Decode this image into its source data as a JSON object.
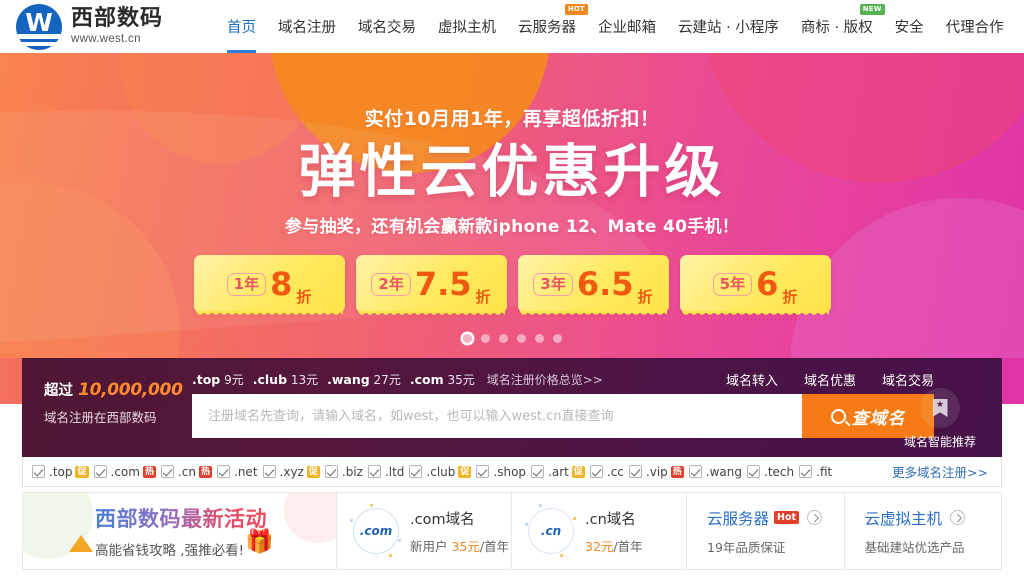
{
  "header": {
    "logo": {
      "name": "西部数码",
      "url": "www.west.cn",
      "icon": "west-logo-icon"
    },
    "nav": [
      {
        "label": "首页",
        "active": true,
        "badge": ""
      },
      {
        "label": "域名注册",
        "active": false,
        "badge": ""
      },
      {
        "label": "域名交易",
        "active": false,
        "badge": ""
      },
      {
        "label": "虚拟主机",
        "active": false,
        "badge": ""
      },
      {
        "label": "云服务器",
        "active": false,
        "badge": "HOT"
      },
      {
        "label": "企业邮箱",
        "active": false,
        "badge": ""
      },
      {
        "label": "云建站 · 小程序",
        "active": false,
        "badge": ""
      },
      {
        "label": "商标 · 版权",
        "active": false,
        "badge": "NEW"
      },
      {
        "label": "安全",
        "active": false,
        "badge": ""
      },
      {
        "label": "代理合作",
        "active": false,
        "badge": ""
      }
    ]
  },
  "banner": {
    "subtitle_top": "实付10月用1年，再享超低折扣！",
    "title": "弹性云优惠升级",
    "subtitle_bottom": "参与抽奖，还有机会赢新款iphone 12、Mate 40手机！",
    "coupons": [
      {
        "years": "1年",
        "value": "8",
        "unit": "折"
      },
      {
        "years": "2年",
        "value": "7.5",
        "unit": "折"
      },
      {
        "years": "3年",
        "value": "6.5",
        "unit": "折"
      },
      {
        "years": "5年",
        "value": "6",
        "unit": "折"
      }
    ],
    "dots": {
      "count": 6,
      "active_index": 0
    }
  },
  "search_panel": {
    "headline": "超过",
    "headline_number": "10,000,000",
    "subline": "域名注册在西部数码",
    "tld_prices": [
      {
        "tld": ".top",
        "price": "9元"
      },
      {
        "tld": ".club",
        "price": "13元"
      },
      {
        "tld": ".wang",
        "price": "27元"
      },
      {
        "tld": ".com",
        "price": "35元"
      }
    ],
    "price_overview_link": "域名注册价格总览>>",
    "quick_links": [
      "域名转入",
      "域名优惠",
      "域名交易"
    ],
    "input_placeholder": "注册域名先查询，请输入域名，如west，也可以输入west.cn直接查询",
    "input_value": "",
    "search_button": "查域名",
    "search_icon": "magnifier-icon",
    "smart_recommend": {
      "label": "域名智能推荐",
      "icon": "bookmark-star-icon"
    }
  },
  "tld_row": {
    "items": [
      {
        "name": ".top",
        "badge": "促",
        "badge_type": "cu",
        "checked": true
      },
      {
        "name": ".com",
        "badge": "热",
        "badge_type": "re",
        "checked": true
      },
      {
        "name": ".cn",
        "badge": "热",
        "badge_type": "re",
        "checked": true
      },
      {
        "name": ".net",
        "badge": "",
        "badge_type": "",
        "checked": true
      },
      {
        "name": ".xyz",
        "badge": "促",
        "badge_type": "cu",
        "checked": true
      },
      {
        "name": ".biz",
        "badge": "",
        "badge_type": "",
        "checked": true
      },
      {
        "name": ".ltd",
        "badge": "",
        "badge_type": "",
        "checked": true
      },
      {
        "name": ".club",
        "badge": "促",
        "badge_type": "cu",
        "checked": true
      },
      {
        "name": ".shop",
        "badge": "",
        "badge_type": "",
        "checked": true
      },
      {
        "name": ".art",
        "badge": "促",
        "badge_type": "cu",
        "checked": true
      },
      {
        "name": ".cc",
        "badge": "",
        "badge_type": "",
        "checked": true
      },
      {
        "name": ".vip",
        "badge": "热",
        "badge_type": "re",
        "checked": true
      },
      {
        "name": ".wang",
        "badge": "",
        "badge_type": "",
        "checked": true
      },
      {
        "name": ".tech",
        "badge": "",
        "badge_type": "",
        "checked": true
      },
      {
        "name": ".fit",
        "badge": "",
        "badge_type": "",
        "checked": true
      }
    ],
    "more_link": "更多域名注册>>"
  },
  "cards": {
    "promo": {
      "title": "西部数码最新活动",
      "subtitle": "高能省钱攻略 ,强推必看!",
      "gift_icon": "gift-icon",
      "triangle_icon": "triangle-icon"
    },
    "domains": [
      {
        "badge_text": ".com",
        "title": ".com域名",
        "prefix": "新用户 ",
        "price": "35元",
        "suffix": "/首年",
        "icon": "com-circle-icon"
      },
      {
        "badge_text": ".cn",
        "title": ".cn域名",
        "prefix": "",
        "price": "32元",
        "suffix": "/首年",
        "icon": "cn-circle-icon"
      }
    ],
    "products": [
      {
        "title": "云服务器",
        "badge": "Hot",
        "subtitle": "19年品质保证",
        "arrow_icon": "chevron-right-circle-icon"
      },
      {
        "title": "云虚拟主机",
        "badge": "",
        "subtitle": "基础建站优选产品",
        "arrow_icon": "chevron-right-circle-icon"
      }
    ]
  }
}
